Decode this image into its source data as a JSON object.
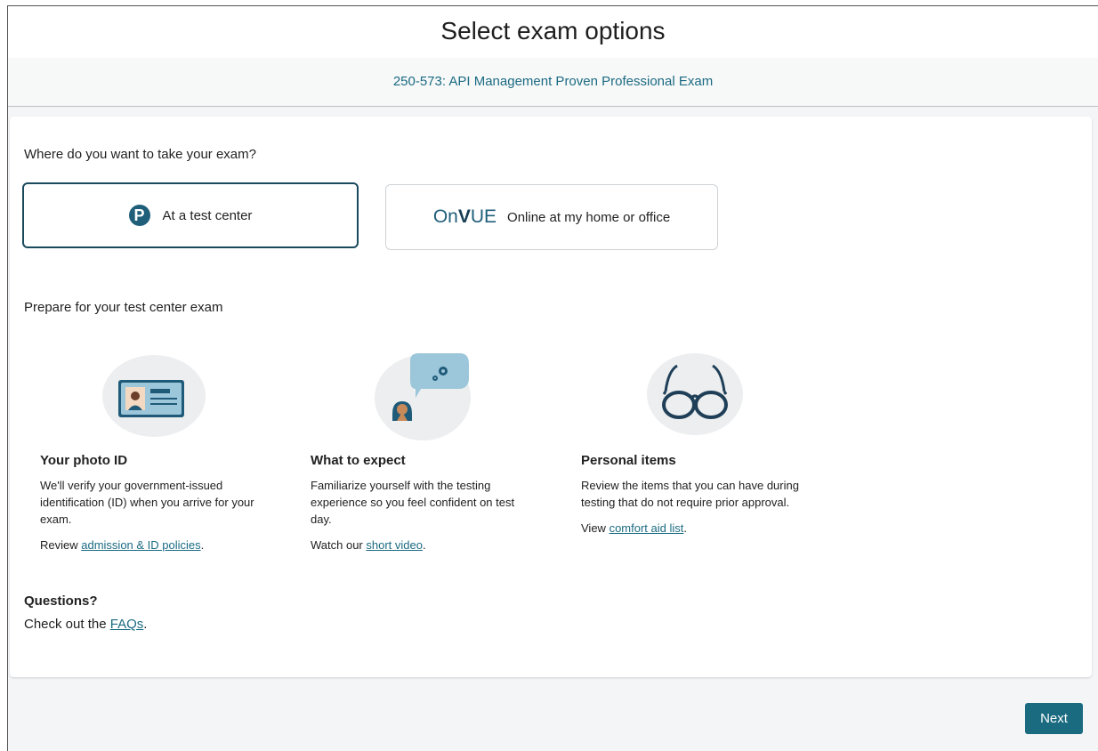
{
  "header": {
    "title": "Select exam options"
  },
  "exam": {
    "name": "250-573: API Management Proven Professional Exam"
  },
  "location": {
    "question": "Where do you want to take your exam?",
    "options": [
      {
        "label": "At a test center",
        "logo_text": "P",
        "selected": true
      },
      {
        "label": "Online at my home or office",
        "logo_text_prefix": "On",
        "logo_text_v": "V",
        "logo_text_suffix": "UE",
        "selected": false
      }
    ]
  },
  "prepare": {
    "heading": "Prepare for your test center exam",
    "items": [
      {
        "title": "Your photo ID",
        "description": "We'll verify your government-issued identification (ID) when you arrive for your exam.",
        "action_prefix": "Review ",
        "link": "admission & ID policies",
        "action_suffix": "."
      },
      {
        "title": "What to expect",
        "description": "Familiarize yourself with the testing experience so you feel confident on test day.",
        "action_prefix": "Watch our ",
        "link": "short video",
        "action_suffix": "."
      },
      {
        "title": "Personal items",
        "description": "Review the items that you can have during testing that do not require prior approval.",
        "action_prefix": "View ",
        "link": "comfort aid list",
        "action_suffix": "."
      }
    ]
  },
  "questions": {
    "title": "Questions?",
    "text_prefix": "Check out the ",
    "link": "FAQs",
    "text_suffix": "."
  },
  "footer": {
    "next_label": "Next"
  },
  "colors": {
    "accent": "#1a6a80",
    "link": "#1b6b82",
    "selected_border": "#1a4a5e"
  }
}
